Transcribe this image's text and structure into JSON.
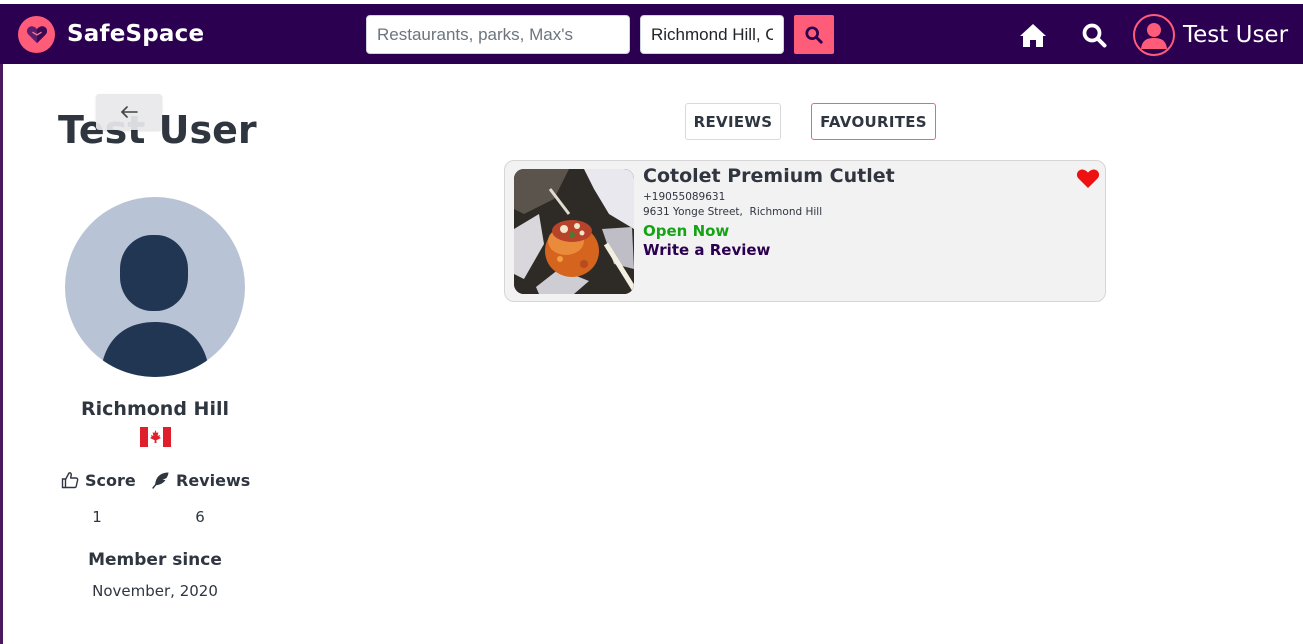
{
  "app": {
    "name": "SafeSpace",
    "brand_color": "#2b0050",
    "accent_color": "#ff5c7a"
  },
  "header": {
    "search": {
      "placeholder": "Restaurants, parks, Max's",
      "value": ""
    },
    "location": {
      "value": "Richmond Hill, C"
    },
    "search_button_icon": "search-icon",
    "home_icon": "home-icon",
    "nav_search_icon": "search-icon",
    "user_icon": "user-avatar-icon",
    "username": "Test User"
  },
  "profile": {
    "back_icon": "arrow-left-icon",
    "name": "Test User",
    "city": "Richmond Hill",
    "country_flag": "canada-flag",
    "score_label": "Score",
    "score_icon": "thumbs-up-icon",
    "score_value": "1",
    "reviews_label": "Reviews",
    "reviews_icon": "feather-icon",
    "reviews_value": "6",
    "member_since_label": "Member since",
    "member_since_date": "November, 2020"
  },
  "tabs": {
    "reviews": "REVIEWS",
    "favourites": "FAVOURITES",
    "active": "favourites"
  },
  "favourites": [
    {
      "name": "Cotolet Premium Cutlet",
      "phone": "+19055089631",
      "address": "9631 Yonge Street,  Richmond Hill",
      "status": "Open Now",
      "status_color": "#16a316",
      "review_link": "Write a Review",
      "heart_icon": "heart-icon",
      "heart_color": "#ee1111"
    }
  ]
}
